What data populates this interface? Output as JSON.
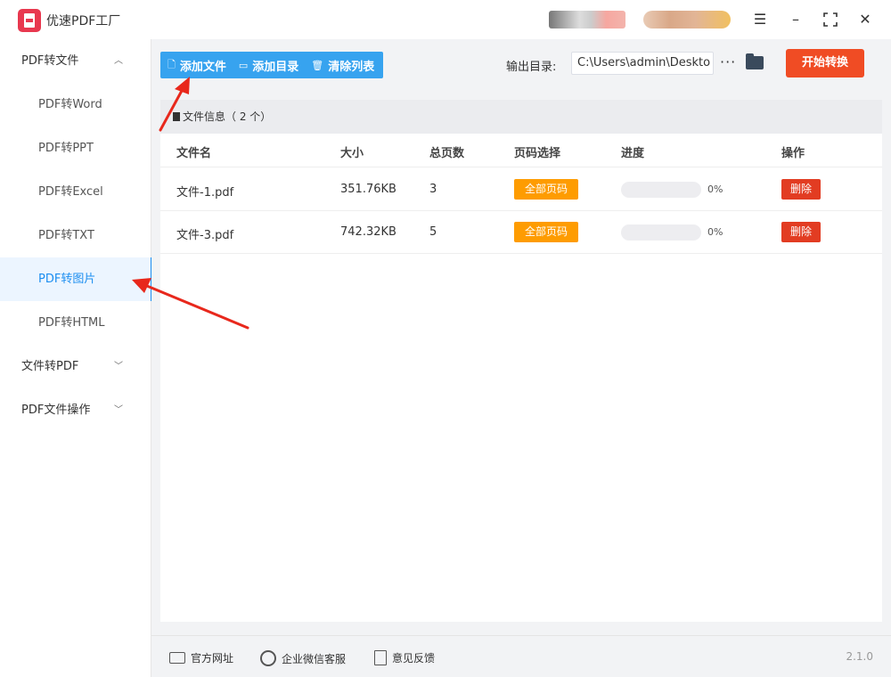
{
  "app": {
    "title": "优速PDF工厂"
  },
  "sidebar": {
    "groups": [
      {
        "label": "PDF转文件",
        "expanded": true
      },
      {
        "label": "文件转PDF",
        "expanded": false
      },
      {
        "label": "PDF文件操作",
        "expanded": false
      }
    ],
    "items": [
      {
        "label": "PDF转Word"
      },
      {
        "label": "PDF转PPT"
      },
      {
        "label": "PDF转Excel"
      },
      {
        "label": "PDF转TXT"
      },
      {
        "label": "PDF转图片",
        "active": true
      },
      {
        "label": "PDF转HTML"
      }
    ]
  },
  "toolbar": {
    "add_file": "添加文件",
    "add_dir": "添加目录",
    "clear_list": "清除列表"
  },
  "output": {
    "label": "输出目录:",
    "path": "C:\\Users\\admin\\Deskto"
  },
  "start_button": "开始转换",
  "panel": {
    "title": "文件信息（ 2 个）",
    "columns": [
      "文件名",
      "大小",
      "总页数",
      "页码选择",
      "进度",
      "操作"
    ],
    "rows": [
      {
        "name": "文件-1.pdf",
        "size": "351.76KB",
        "pages": "3",
        "page_select": "全部页码",
        "progress": 0,
        "progress_text": "0%",
        "action": "删除"
      },
      {
        "name": "文件-3.pdf",
        "size": "742.32KB",
        "pages": "5",
        "page_select": "全部页码",
        "progress": 0,
        "progress_text": "0%",
        "action": "删除"
      }
    ]
  },
  "footer": {
    "website": "官方网址",
    "wechat": "企业微信客服",
    "feedback": "意见反馈",
    "version": "2.1.0"
  },
  "colors": {
    "accent": "#1c8ef0",
    "toolbar": "#37a3ef",
    "start": "#f04c24",
    "badge": "#fe9c01",
    "delete": "#e23c22",
    "annotation": "#e8281c"
  }
}
